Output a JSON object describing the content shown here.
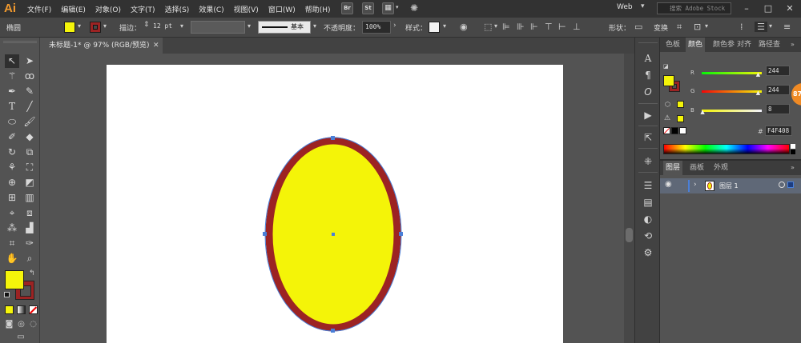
{
  "app": {
    "logo": "Ai",
    "badge": "87"
  },
  "menu": [
    "文件(F)",
    "编辑(E)",
    "对象(O)",
    "文字(T)",
    "选择(S)",
    "效果(C)",
    "视图(V)",
    "窗口(W)",
    "帮助(H)"
  ],
  "menubar": {
    "bridge": "Br",
    "stock": "St",
    "workspace": "Web",
    "search_placeholder": "搜索 Adobe Stock"
  },
  "controlbar": {
    "object_type": "椭圆",
    "stroke_label": "描边：",
    "stroke_weight": "12 pt",
    "brush": "基本",
    "opacity_label": "不透明度：",
    "opacity": "100%",
    "style_label": "样式：",
    "shape_label": "形状：",
    "transform_label": "变换",
    "fill_color": "#F5F50A",
    "stroke_color": "#9C2323"
  },
  "document": {
    "tab_title": "未标题-1* @ 97% (RGB/预览)",
    "close": "✕"
  },
  "artwork": {
    "fill_color": "#F4F408",
    "stroke_color": "#9C2323",
    "selection_color": "#4A7FD8"
  },
  "color_panel": {
    "tabs": [
      "色板",
      "颜色",
      "颜色参",
      "对齐",
      "路径查"
    ],
    "active_tab": "颜色",
    "channels": [
      {
        "label": "R",
        "value": "244",
        "level": 0.957
      },
      {
        "label": "G",
        "value": "244",
        "level": 0.957
      },
      {
        "label": "B",
        "value": "8",
        "level": 0.031
      }
    ],
    "hex_prefix": "#",
    "hex": "F4F408"
  },
  "layers_panel": {
    "tabs": [
      "图层",
      "画板",
      "外观"
    ],
    "active_tab": "图层",
    "layer_name": "图层 1"
  }
}
